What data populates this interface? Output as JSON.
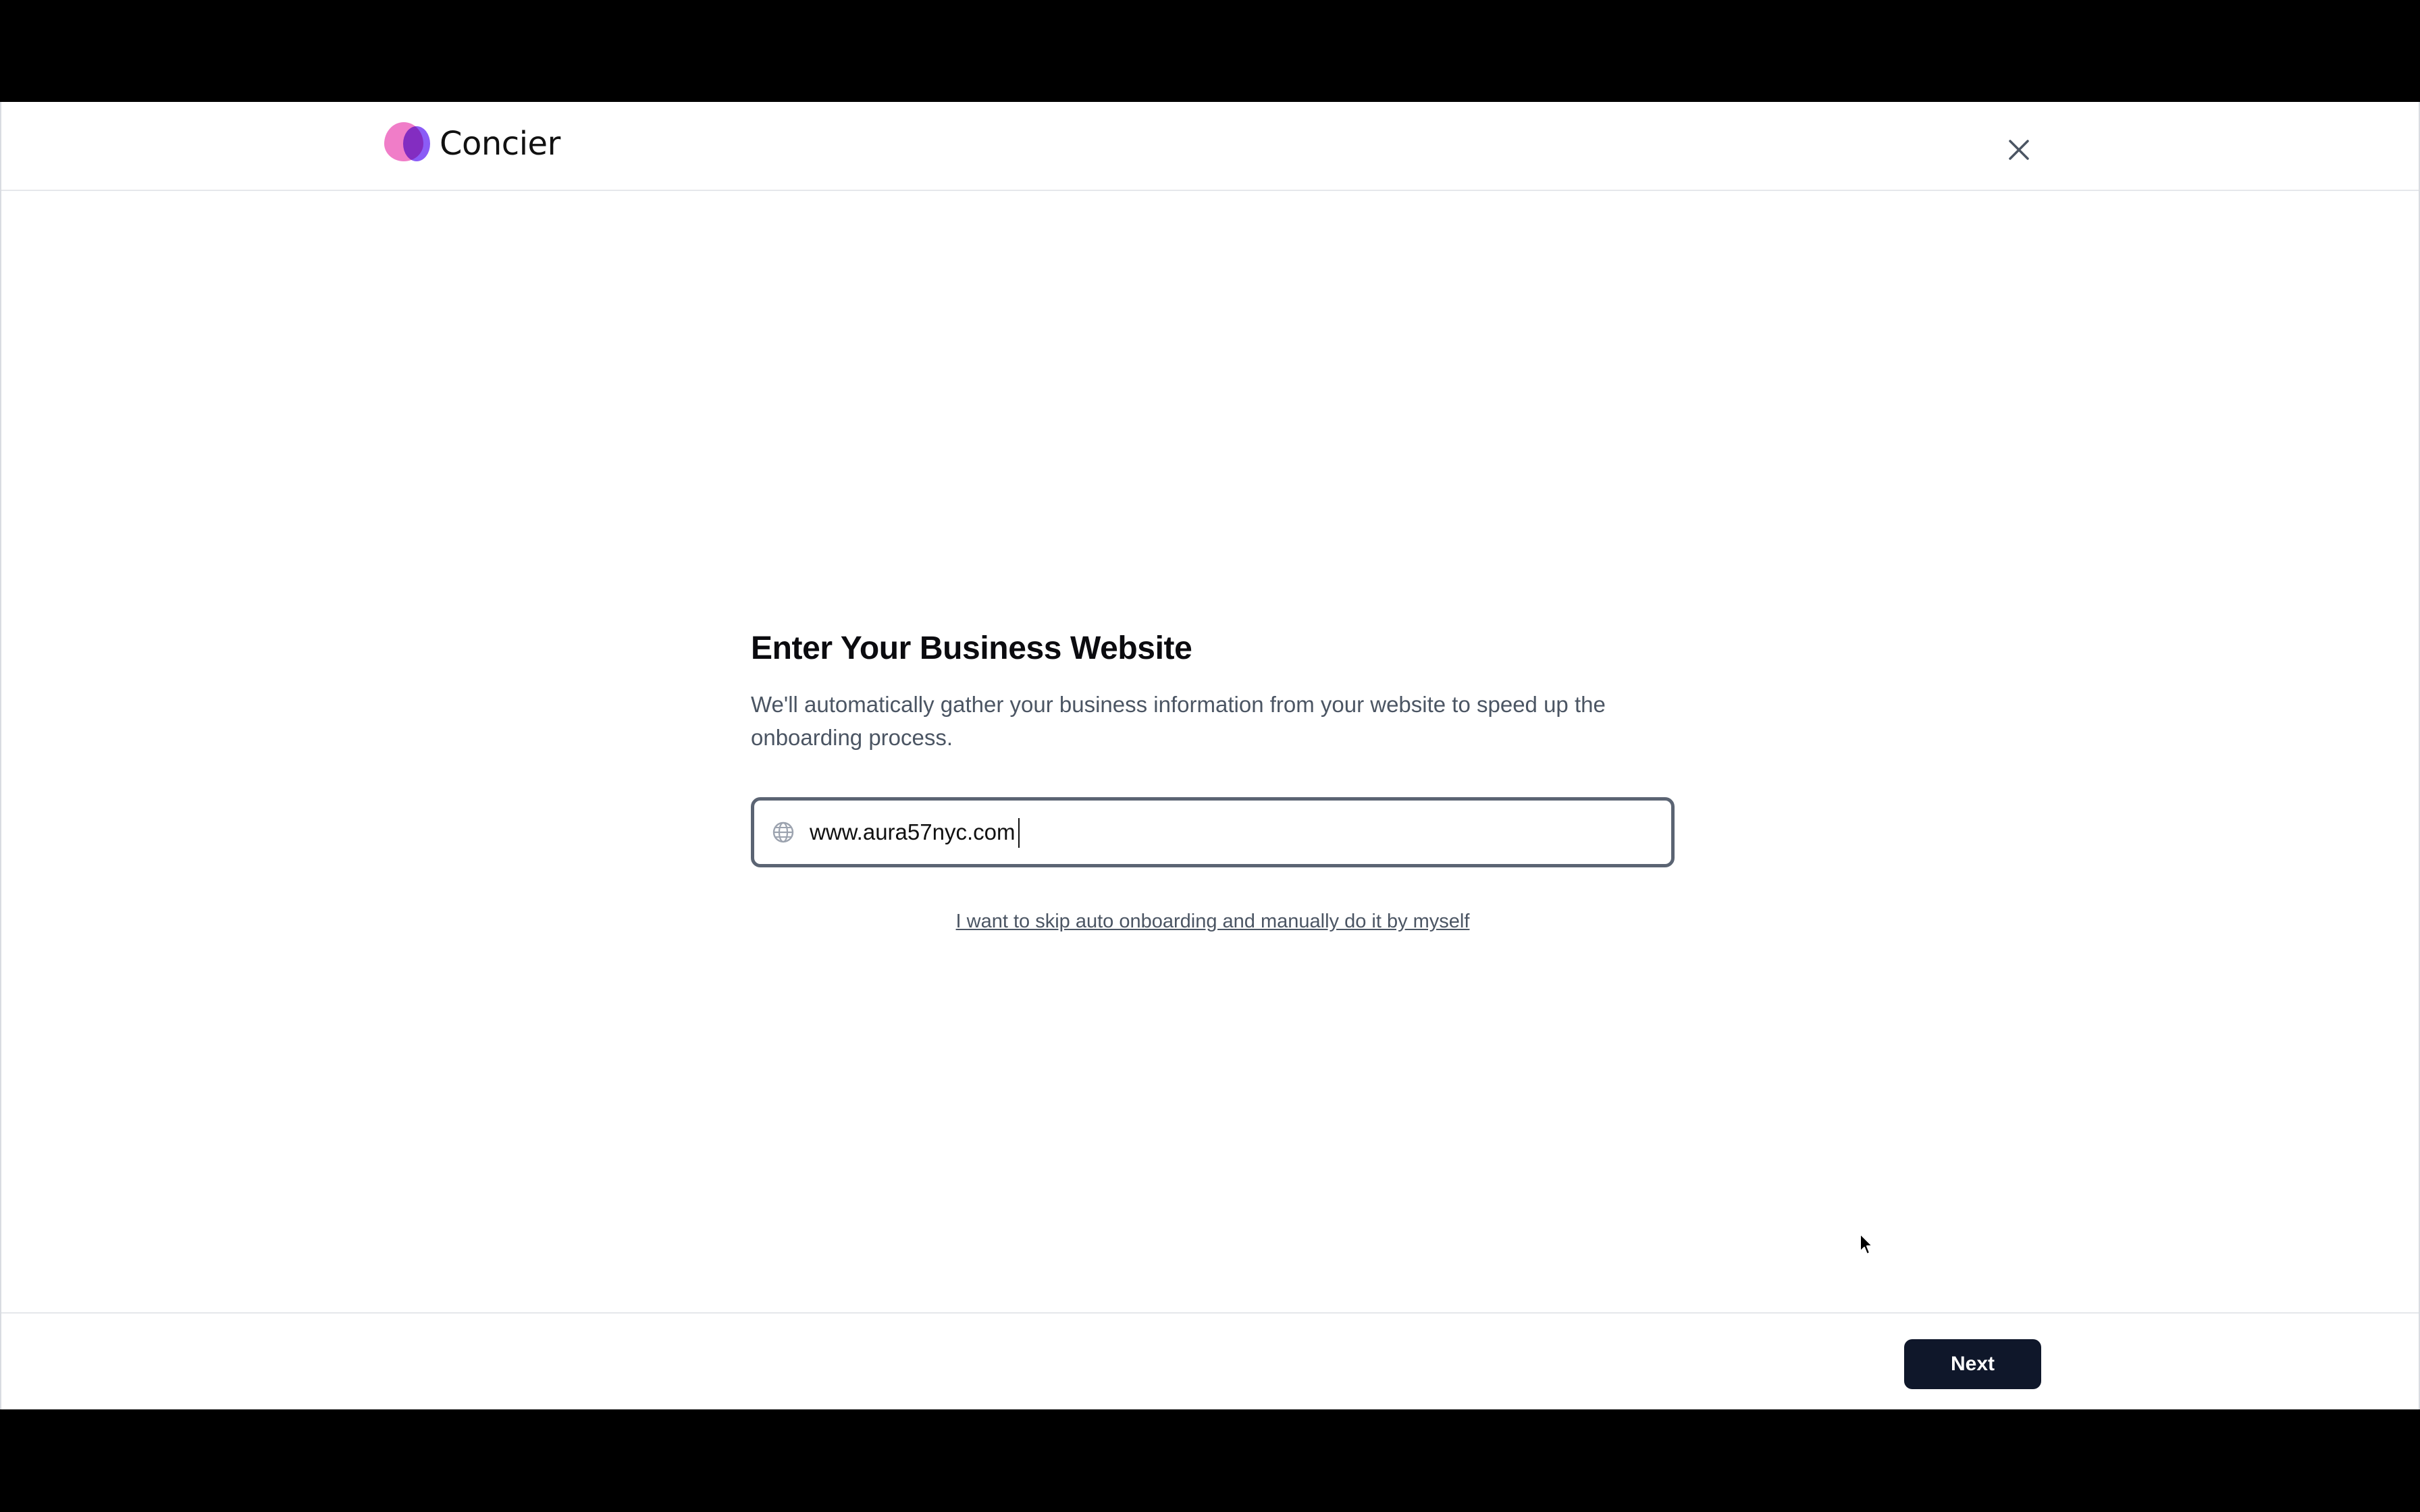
{
  "header": {
    "brand_name": "Concier",
    "logo_colors": {
      "pink": "#f07dc8",
      "purple": "#8b5cf6"
    },
    "close_icon": "close-icon"
  },
  "onboarding": {
    "title": "Enter Your Business Website",
    "description": "We'll automatically gather your business information from your website to speed up the onboarding process.",
    "website_field": {
      "icon": "globe-icon",
      "value": "www.aura57nyc.com"
    },
    "skip_link": "I want to skip auto onboarding and manually do it by myself"
  },
  "footer": {
    "next_label": "Next",
    "next_color": "#0f172a"
  }
}
